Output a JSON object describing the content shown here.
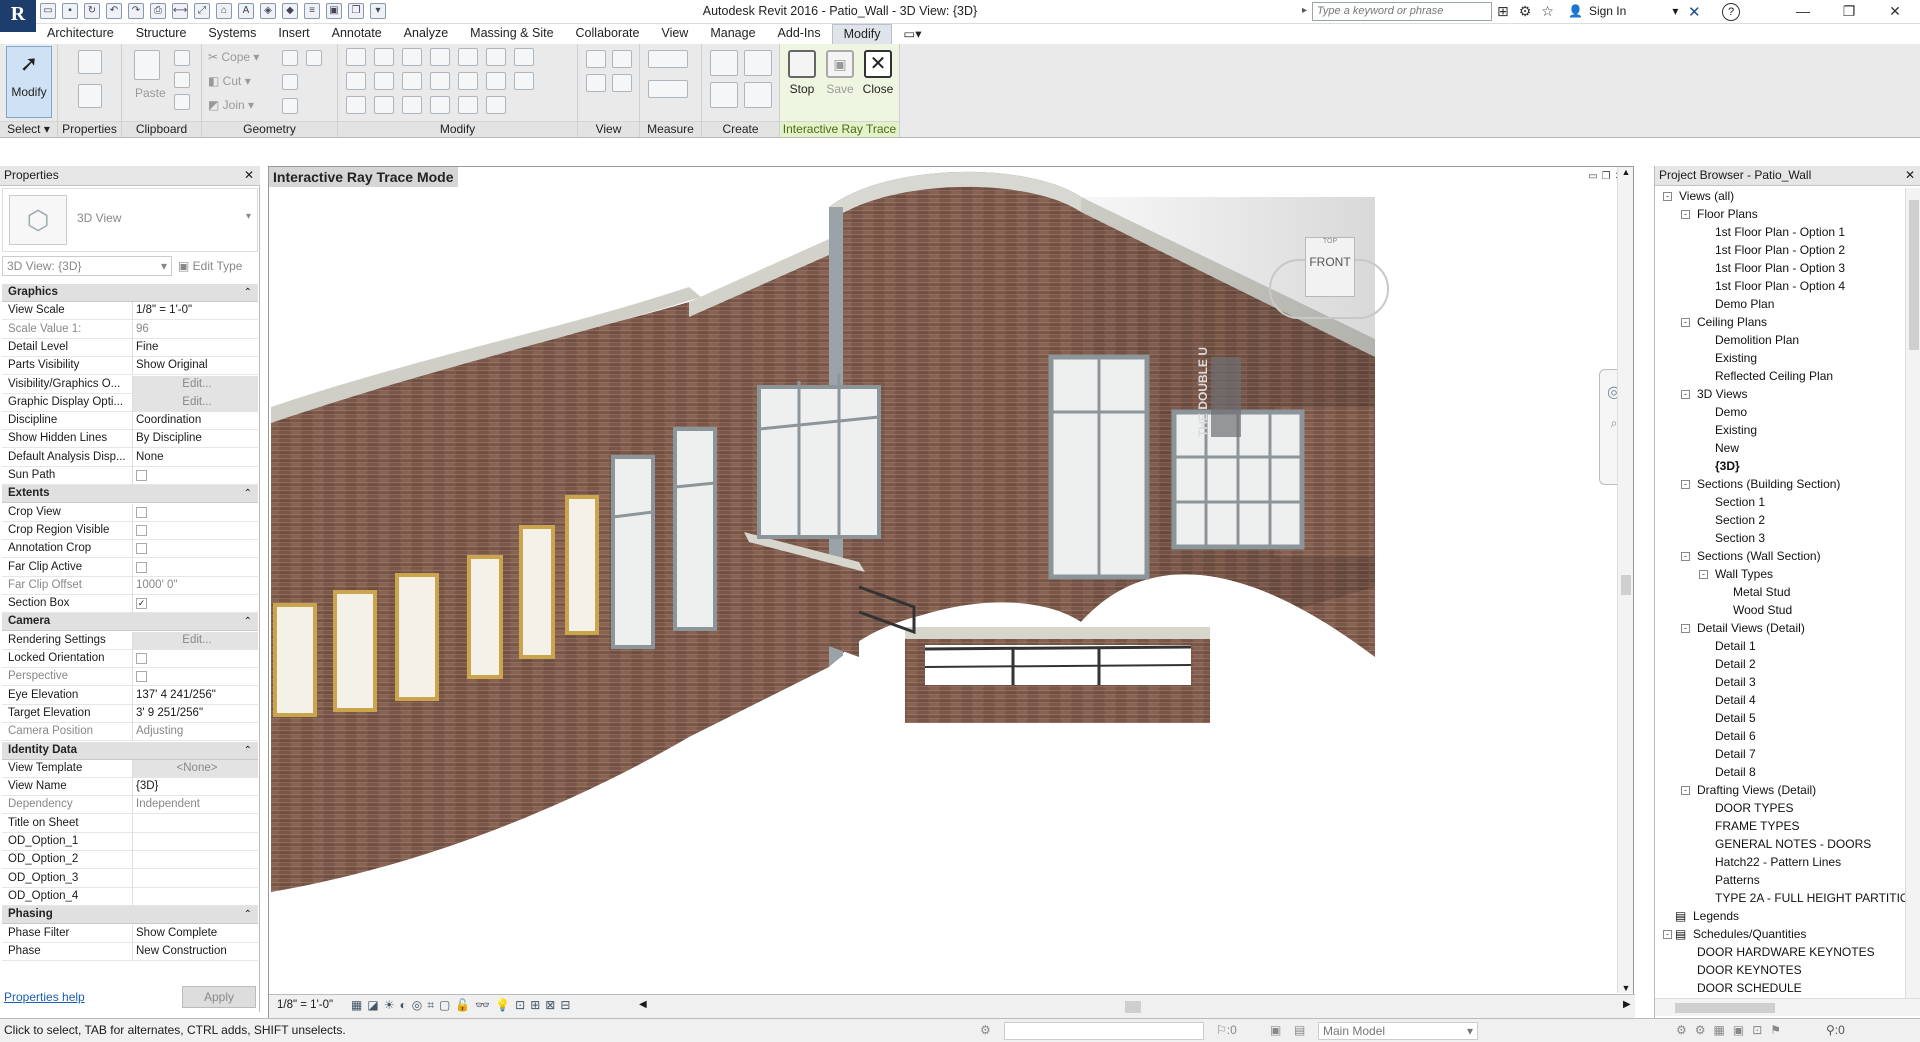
{
  "app": {
    "logo": "R",
    "title": "Autodesk Revit 2016 -    Patio_Wall - 3D View: {3D}",
    "search_placeholder": "Type a keyword or phrase",
    "sign_in": "Sign In"
  },
  "tabs": [
    "Architecture",
    "Structure",
    "Systems",
    "Insert",
    "Annotate",
    "Analyze",
    "Massing & Site",
    "Collaborate",
    "View",
    "Manage",
    "Add-Ins",
    "Modify"
  ],
  "active_tab": "Modify",
  "ribbon": {
    "modify_label": "Modify",
    "select_label": "Select",
    "properties_label": "Properties",
    "clipboard_label": "Clipboard",
    "geometry_label": "Geometry",
    "modify_group_label": "Modify",
    "view_label": "View",
    "measure_label": "Measure",
    "create_label": "Create",
    "raytrace_label": "Interactive Ray Trace",
    "paste_label": "Paste",
    "cope_label": "Cope",
    "cut_label": "Cut",
    "join_label": "Join",
    "stop_label": "Stop",
    "save_label": "Save",
    "close_label": "Close"
  },
  "properties": {
    "title": "Properties",
    "type_name": "3D View",
    "instance_selector": "3D View: {3D}",
    "edit_type": "Edit Type",
    "help": "Properties help",
    "apply": "Apply",
    "rows": [
      {
        "name": "Graphics",
        "section": true
      },
      {
        "name": "View Scale",
        "value": "1/8\" = 1'-0\""
      },
      {
        "name": "Scale Value    1:",
        "value": "96",
        "dim": true
      },
      {
        "name": "Detail Level",
        "value": "Fine"
      },
      {
        "name": "Parts Visibility",
        "value": "Show Original"
      },
      {
        "name": "Visibility/Graphics O...",
        "value": "Edit...",
        "edit": true
      },
      {
        "name": "Graphic Display Opti...",
        "value": "Edit...",
        "edit": true
      },
      {
        "name": "Discipline",
        "value": "Coordination"
      },
      {
        "name": "Show Hidden Lines",
        "value": "By Discipline"
      },
      {
        "name": "Default Analysis Disp...",
        "value": "None"
      },
      {
        "name": "Sun Path",
        "value": "",
        "check": true
      },
      {
        "name": "Extents",
        "section": true
      },
      {
        "name": "Crop View",
        "value": "",
        "check": true
      },
      {
        "name": "Crop Region Visible",
        "value": "",
        "check": true
      },
      {
        "name": "Annotation Crop",
        "value": "",
        "check": true
      },
      {
        "name": "Far Clip Active",
        "value": "",
        "check": true
      },
      {
        "name": "Far Clip Offset",
        "value": "1000'  0\"",
        "dim": true
      },
      {
        "name": "Section Box",
        "value": "✓",
        "check": true
      },
      {
        "name": "Camera",
        "section": true
      },
      {
        "name": "Rendering Settings",
        "value": "Edit...",
        "edit": true
      },
      {
        "name": "Locked Orientation",
        "value": "",
        "check": true
      },
      {
        "name": "Perspective",
        "value": "",
        "check": true,
        "dim": true
      },
      {
        "name": "Eye Elevation",
        "value": "137'  4 241/256\""
      },
      {
        "name": "Target Elevation",
        "value": "3'  9 251/256\""
      },
      {
        "name": "Camera Position",
        "value": "Adjusting",
        "dim": true
      },
      {
        "name": "Identity Data",
        "section": true
      },
      {
        "name": "View Template",
        "value": "<None>",
        "edit": true
      },
      {
        "name": "View Name",
        "value": "{3D}"
      },
      {
        "name": "Dependency",
        "value": "Independent",
        "dim": true
      },
      {
        "name": "Title on Sheet",
        "value": ""
      },
      {
        "name": "OD_Option_1",
        "value": ""
      },
      {
        "name": "OD_Option_2",
        "value": ""
      },
      {
        "name": "OD_Option_3",
        "value": ""
      },
      {
        "name": "OD_Option_4",
        "value": ""
      },
      {
        "name": "Phasing",
        "section": true
      },
      {
        "name": "Phase Filter",
        "value": "Show Complete"
      },
      {
        "name": "Phase",
        "value": "New Construction"
      }
    ]
  },
  "view": {
    "mode_label": "Interactive Ray Trace Mode",
    "scale": "1/8\" = 1'-0\"",
    "viewcube_face": "FRONT",
    "viewcube_top": "TOP",
    "sign_text": "THE DOUBLE U"
  },
  "browser": {
    "title": "Project Browser - Patio_Wall",
    "nodes": [
      {
        "label": "Views (all)",
        "level": 0,
        "toggle": "-"
      },
      {
        "label": "Floor Plans",
        "level": 1,
        "toggle": "-"
      },
      {
        "label": "1st Floor Plan - Option 1",
        "level": 2
      },
      {
        "label": "1st Floor Plan - Option 2",
        "level": 2
      },
      {
        "label": "1st Floor Plan - Option 3",
        "level": 2
      },
      {
        "label": "1st Floor Plan - Option 4",
        "level": 2
      },
      {
        "label": "Demo Plan",
        "level": 2
      },
      {
        "label": "Ceiling Plans",
        "level": 1,
        "toggle": "-"
      },
      {
        "label": "Demolition Plan",
        "level": 2
      },
      {
        "label": "Existing",
        "level": 2
      },
      {
        "label": "Reflected Ceiling Plan",
        "level": 2
      },
      {
        "label": "3D Views",
        "level": 1,
        "toggle": "-"
      },
      {
        "label": "Demo",
        "level": 2
      },
      {
        "label": "Existing",
        "level": 2
      },
      {
        "label": "New",
        "level": 2
      },
      {
        "label": "{3D}",
        "level": 2,
        "bold": true
      },
      {
        "label": "Sections (Building Section)",
        "level": 1,
        "toggle": "-"
      },
      {
        "label": "Section 1",
        "level": 2
      },
      {
        "label": "Section 2",
        "level": 2
      },
      {
        "label": "Section 3",
        "level": 2
      },
      {
        "label": "Sections (Wall Section)",
        "level": 1,
        "toggle": "-"
      },
      {
        "label": "Wall Types",
        "level": 2,
        "toggle": "-"
      },
      {
        "label": "Metal Stud",
        "level": 3
      },
      {
        "label": "Wood Stud",
        "level": 3
      },
      {
        "label": "Detail Views (Detail)",
        "level": 1,
        "toggle": "-"
      },
      {
        "label": "Detail 1",
        "level": 2
      },
      {
        "label": "Detail 2",
        "level": 2
      },
      {
        "label": "Detail 3",
        "level": 2
      },
      {
        "label": "Detail 4",
        "level": 2
      },
      {
        "label": "Detail 5",
        "level": 2
      },
      {
        "label": "Detail 6",
        "level": 2
      },
      {
        "label": "Detail 7",
        "level": 2
      },
      {
        "label": "Detail 8",
        "level": 2
      },
      {
        "label": "Drafting Views (Detail)",
        "level": 1,
        "toggle": "-"
      },
      {
        "label": "DOOR TYPES",
        "level": 2
      },
      {
        "label": "FRAME TYPES",
        "level": 2
      },
      {
        "label": "GENERAL NOTES - DOORS",
        "level": 2
      },
      {
        "label": "Hatch22 - Pattern Lines",
        "level": 2
      },
      {
        "label": "Patterns",
        "level": 2
      },
      {
        "label": "TYPE 2A - FULL HEIGHT PARTITION",
        "level": 2
      },
      {
        "label": "Legends",
        "level": 0,
        "icon": true
      },
      {
        "label": "Schedules/Quantities",
        "level": 0,
        "toggle": "-",
        "icon": true
      },
      {
        "label": "DOOR HARDWARE KEYNOTES",
        "level": 1
      },
      {
        "label": "DOOR KEYNOTES",
        "level": 1
      },
      {
        "label": "DOOR SCHEDULE",
        "level": 1
      }
    ]
  },
  "status": {
    "hint": "Click to select, TAB for alternates, CTRL adds, SHIFT unselects.",
    "filter_count": ":0",
    "model": "Main Model",
    "select_count": ":0"
  },
  "colors": {
    "brick": "#7a5444",
    "ribbon_active": "#cfe2f5",
    "raytrace_green": "#e3f2c8"
  }
}
